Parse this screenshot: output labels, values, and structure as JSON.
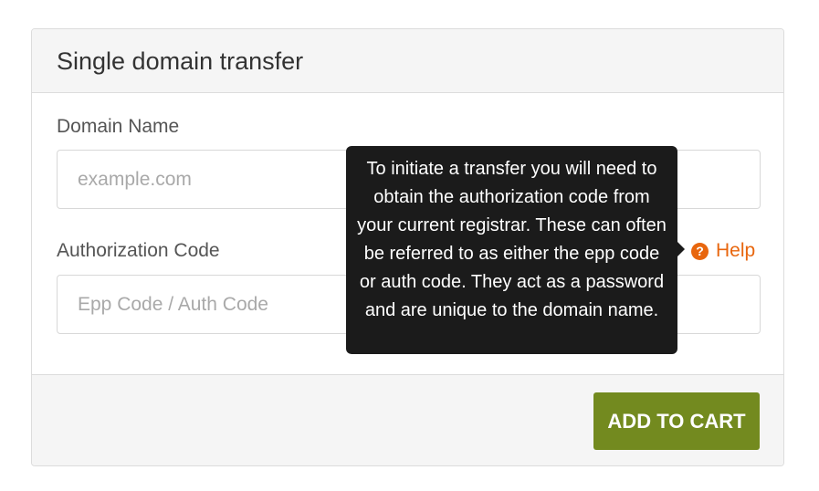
{
  "panel": {
    "title": "Single domain transfer"
  },
  "form": {
    "domain": {
      "label": "Domain Name",
      "placeholder": "example.com",
      "value": ""
    },
    "auth": {
      "label": "Authorization Code",
      "placeholder": "Epp Code / Auth Code",
      "value": ""
    },
    "help": {
      "icon": "question-circle-icon",
      "label": "Help",
      "color": "#e8660e"
    }
  },
  "tooltip": {
    "text": "To initiate a transfer you will need to obtain the authorization code from your current registrar. These can often be referred to as either the epp code or auth code. They act as a password and are unique to the domain name."
  },
  "footer": {
    "add_button_label": "ADD TO CART",
    "button_color": "#738a1f"
  }
}
